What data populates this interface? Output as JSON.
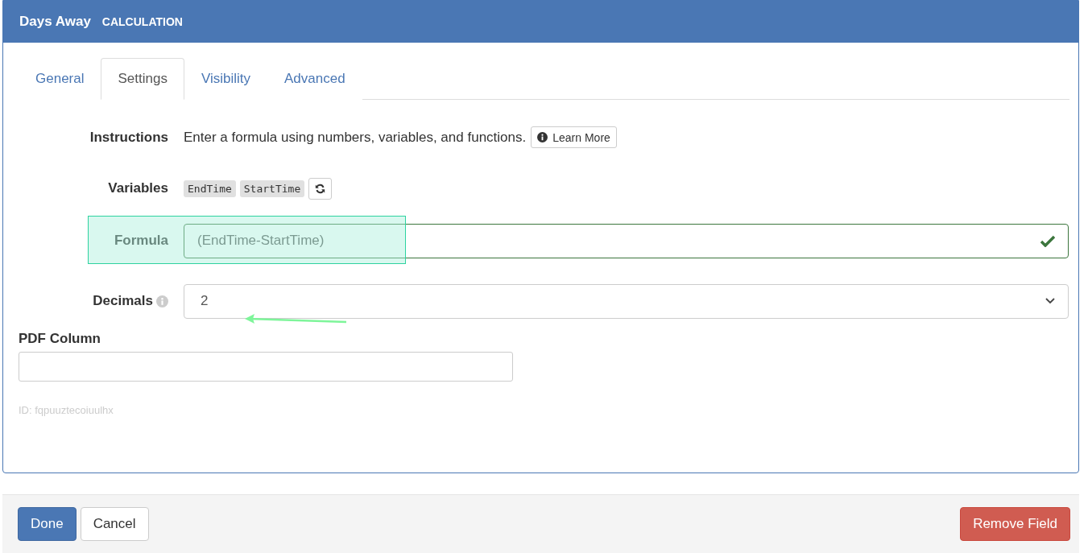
{
  "header": {
    "title": "Days Away",
    "type": "CALCULATION"
  },
  "tabs": [
    {
      "label": "General",
      "selected": false
    },
    {
      "label": "Settings",
      "selected": true
    },
    {
      "label": "Visibility",
      "selected": false
    },
    {
      "label": "Advanced",
      "selected": false
    }
  ],
  "instructions": {
    "label": "Instructions",
    "text": "Enter a formula using numbers, variables, and functions.",
    "button": "Learn More"
  },
  "variables": {
    "label": "Variables",
    "items": [
      "EndTime",
      "StartTime"
    ]
  },
  "formula": {
    "label": "Formula",
    "value": "(EndTime-StartTime)",
    "valid": true,
    "highlighted": true
  },
  "decimals": {
    "label": "Decimals",
    "value": "2",
    "arrow": true
  },
  "pdf_column": {
    "label": "PDF Column"
  },
  "id_text": "ID: fqpuuztecoiuulhx",
  "footer": {
    "done": "Done",
    "cancel": "Cancel",
    "remove": "Remove Field"
  }
}
